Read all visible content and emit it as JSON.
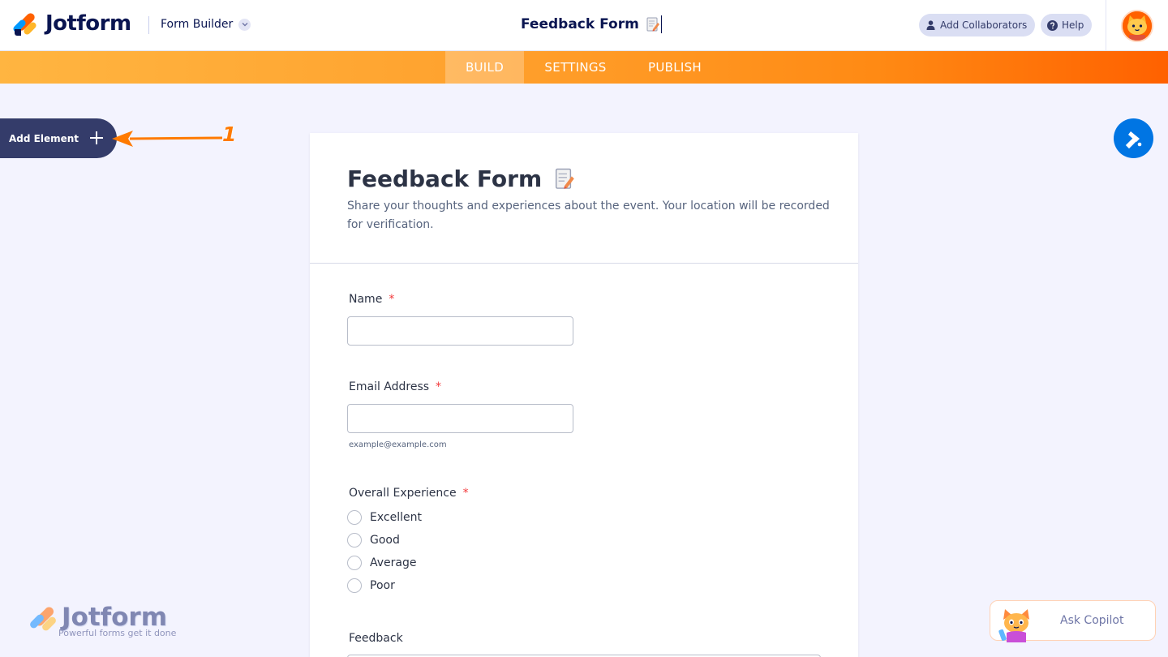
{
  "header": {
    "brand": "Jotform",
    "form_builder_label": "Form Builder",
    "form_title": "Feedback Form",
    "add_collaborators_label": "Add Collaborators",
    "help_label": "Help"
  },
  "nav": {
    "tabs": [
      {
        "label": "BUILD",
        "active": true
      },
      {
        "label": "SETTINGS",
        "active": false
      },
      {
        "label": "PUBLISH",
        "active": false
      }
    ]
  },
  "sidebar": {
    "add_element_label": "Add Element",
    "annotation_number": "1"
  },
  "form": {
    "title": "Feedback Form",
    "description": "Share your thoughts and experiences about the event. Your location will be recorded for verification.",
    "fields": {
      "name": {
        "label": "Name",
        "required_mark": "*",
        "value": ""
      },
      "email": {
        "label": "Email Address",
        "required_mark": "*",
        "value": "",
        "sublabel": "example@example.com"
      },
      "experience": {
        "label": "Overall Experience",
        "required_mark": "*",
        "options": [
          "Excellent",
          "Good",
          "Average",
          "Poor"
        ]
      },
      "feedback": {
        "label": "Feedback"
      }
    }
  },
  "watermark": {
    "brand": "Jotform",
    "tagline": "Powerful forms get it done"
  },
  "copilot": {
    "label": "Ask Copilot"
  },
  "colors": {
    "brand_navy": "#0a1551",
    "accent_orange": "#ff6100",
    "accent_blue": "#0075e3",
    "required_red": "#f23a3c",
    "annotation_orange": "#ff7a00"
  }
}
